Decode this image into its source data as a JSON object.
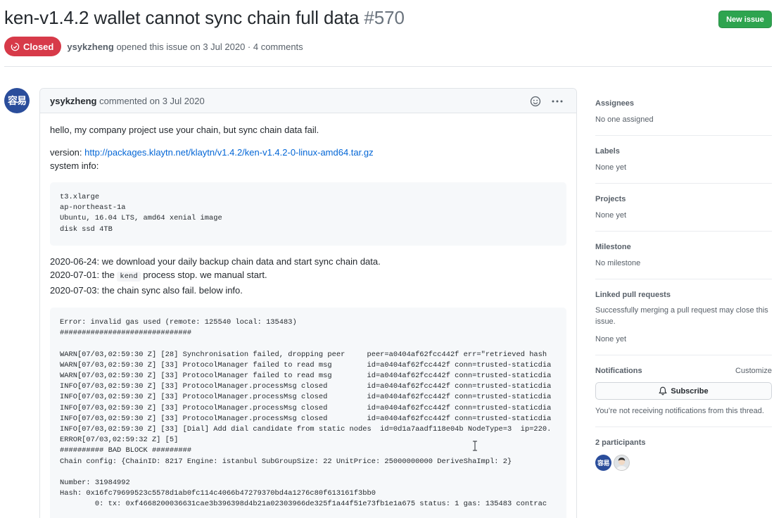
{
  "issue": {
    "title": "ken-v1.4.2 wallet cannot sync chain full data",
    "number": "#570",
    "state": "Closed",
    "author": "ysykzheng",
    "meta_suffix": "opened this issue on 3 Jul 2020 · 4 comments",
    "new_issue_label": "New issue"
  },
  "comment": {
    "author": "ysykzheng",
    "timestamp": "commented on 3 Jul 2020",
    "avatar_text": "容易",
    "intro": "hello, my company project use your chain, but sync chain data fail.",
    "version_label": "version:",
    "version_link": "http://packages.klaytn.net/klaytn/v1.4.2/ken-v1.4.2-0-linux-amd64.tar.gz",
    "system_info_label": "system info:",
    "system_info_code": "t3.xlarge\nap-northeast-1a\nUbuntu, 16.04 LTS, amd64 xenial image\ndisk ssd 4TB",
    "timeline_1": "2020-06-24: we download your daily backup chain data and start sync chain data.",
    "timeline_2_prefix": "2020-07-01: the",
    "timeline_2_code": "kend",
    "timeline_2_suffix": "process stop. we manual start.",
    "timeline_3": "2020-07-03: the chain sync also fail. below info.",
    "log_code": "Error: invalid gas used (remote: 125540 local: 135483)\n##############################\n\nWARN[07/03,02:59:30 Z] [28] Synchronisation failed, dropping peer     peer=a0404af62fcc442f err=\"retrieved hash\nWARN[07/03,02:59:30 Z] [33] ProtocolManager failed to read msg        id=a0404af62fcc442f conn=trusted-staticdia\nWARN[07/03,02:59:30 Z] [33] ProtocolManager failed to read msg        id=a0404af62fcc442f conn=trusted-staticdia\nINFO[07/03,02:59:30 Z] [33] ProtocolManager.processMsg closed         id=a0404af62fcc442f conn=trusted-staticdia\nINFO[07/03,02:59:30 Z] [33] ProtocolManager.processMsg closed         id=a0404af62fcc442f conn=trusted-staticdia\nINFO[07/03,02:59:30 Z] [33] ProtocolManager.processMsg closed         id=a0404af62fcc442f conn=trusted-staticdia\nINFO[07/03,02:59:30 Z] [33] ProtocolManager.processMsg closed         id=a0404af62fcc442f conn=trusted-staticdia\nINFO[07/03,02:59:30 Z] [33] [Dial] Add dial candidate from static nodes  id=0d1a7aadf118e04b NodeType=3  ip=220.\nERROR[07/03,02:59:32 Z] [5]\n########## BAD BLOCK #########\nChain config: {ChainID: 8217 Engine: istanbul SubGroupSize: 22 UnitPrice: 25000000000 DeriveShaImpl: 2}\n\nNumber: 31984992\nHash: 0x16fc79699523c5578d1ab0fc114c4066b47279370bd4a1276c80f613161f3bb0\n        0: tx: 0xf4668200036631cae3b396398d4b21a02303966de325f1a44f51e73fb1e1a675 status: 1 gas: 135483 contrac"
  },
  "sidebar": {
    "assignees": {
      "label": "Assignees",
      "value": "No one assigned"
    },
    "labels": {
      "label": "Labels",
      "value": "None yet"
    },
    "projects": {
      "label": "Projects",
      "value": "None yet"
    },
    "milestone": {
      "label": "Milestone",
      "value": "No milestone"
    },
    "linked_prs": {
      "label": "Linked pull requests",
      "note": "Successfully merging a pull request may close this issue.",
      "value": "None yet"
    },
    "notifications": {
      "label": "Notifications",
      "customize": "Customize",
      "subscribe": "Subscribe",
      "note": "You’re not receiving notifications from this thread."
    },
    "participants": {
      "label": "2 participants",
      "avatar_1_text": "容易"
    }
  },
  "colors": {
    "closed_badge": "#d73a49",
    "new_issue_button": "#2ea44f",
    "link": "#0366d6",
    "avatar": "#2a4d9b"
  }
}
